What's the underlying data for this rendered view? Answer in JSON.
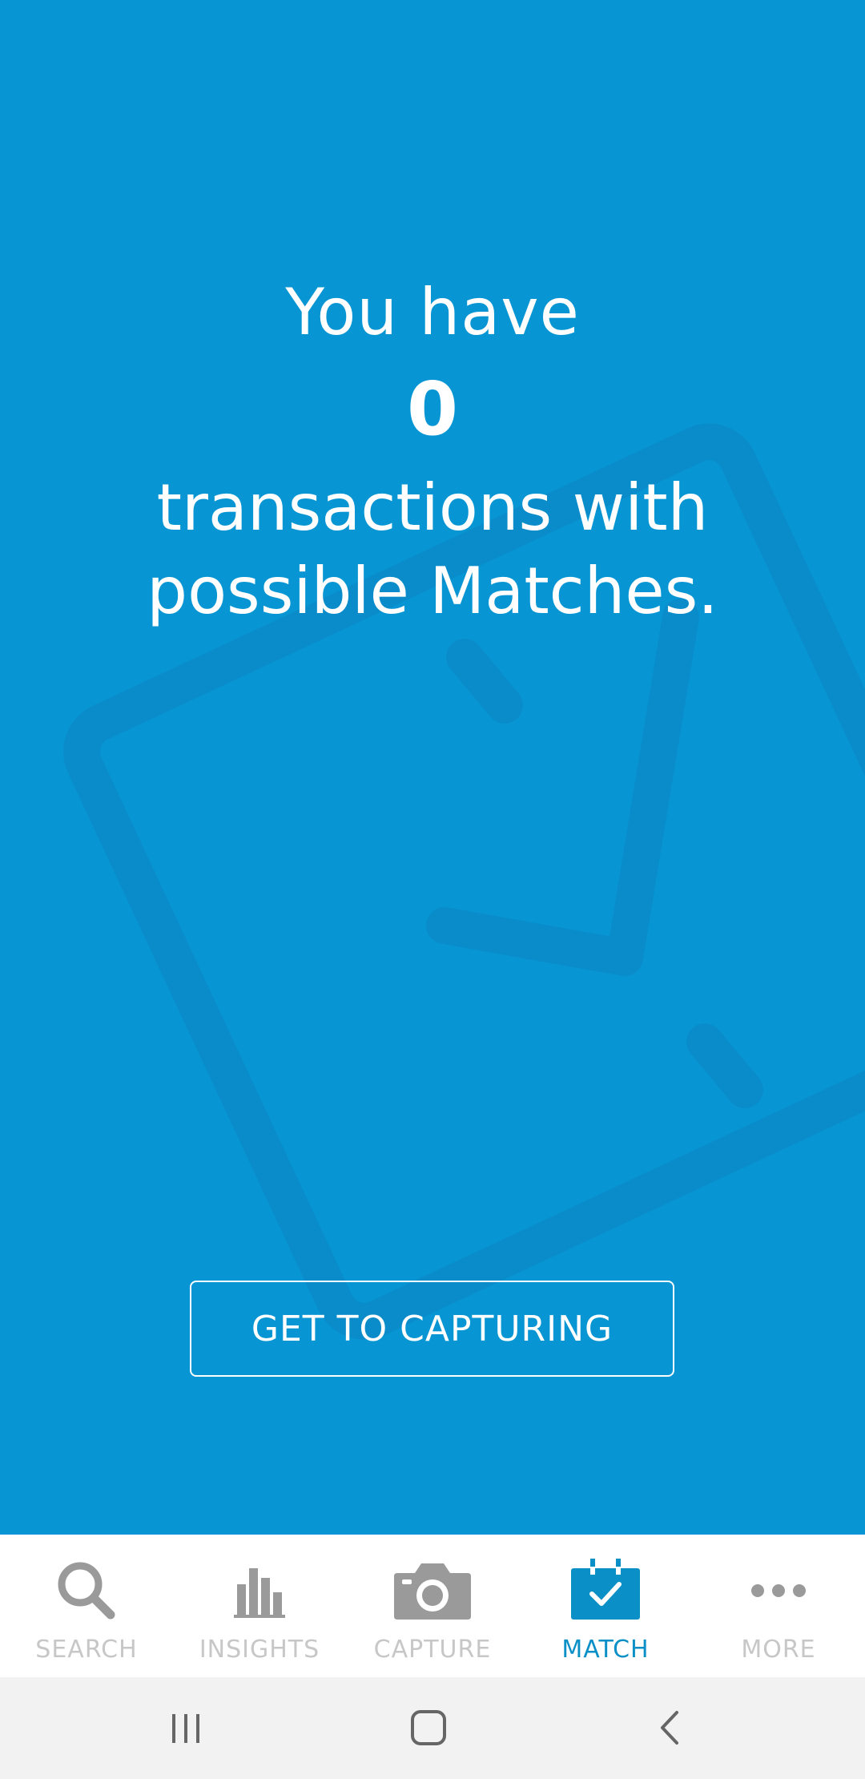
{
  "hero": {
    "line1": "You have",
    "count": "0",
    "line3a": "transactions with",
    "line3b": "possible Matches."
  },
  "cta": {
    "label": "GET TO CAPTURING"
  },
  "tabs": [
    {
      "label": "SEARCH",
      "icon": "search-icon",
      "active": false
    },
    {
      "label": "INSIGHTS",
      "icon": "bar-chart-icon",
      "active": false
    },
    {
      "label": "CAPTURE",
      "icon": "camera-icon",
      "active": false
    },
    {
      "label": "MATCH",
      "icon": "calendar-check-icon",
      "active": true
    },
    {
      "label": "MORE",
      "icon": "more-dots-icon",
      "active": false
    }
  ],
  "colors": {
    "background": "#0796D3",
    "active_tab": "#0A8FC6",
    "inactive_tab": "#C7C7C7",
    "icon_gray": "#9A9A9A"
  },
  "system_nav": {
    "recent": "recent-apps-icon",
    "home": "home-icon",
    "back": "back-icon"
  }
}
